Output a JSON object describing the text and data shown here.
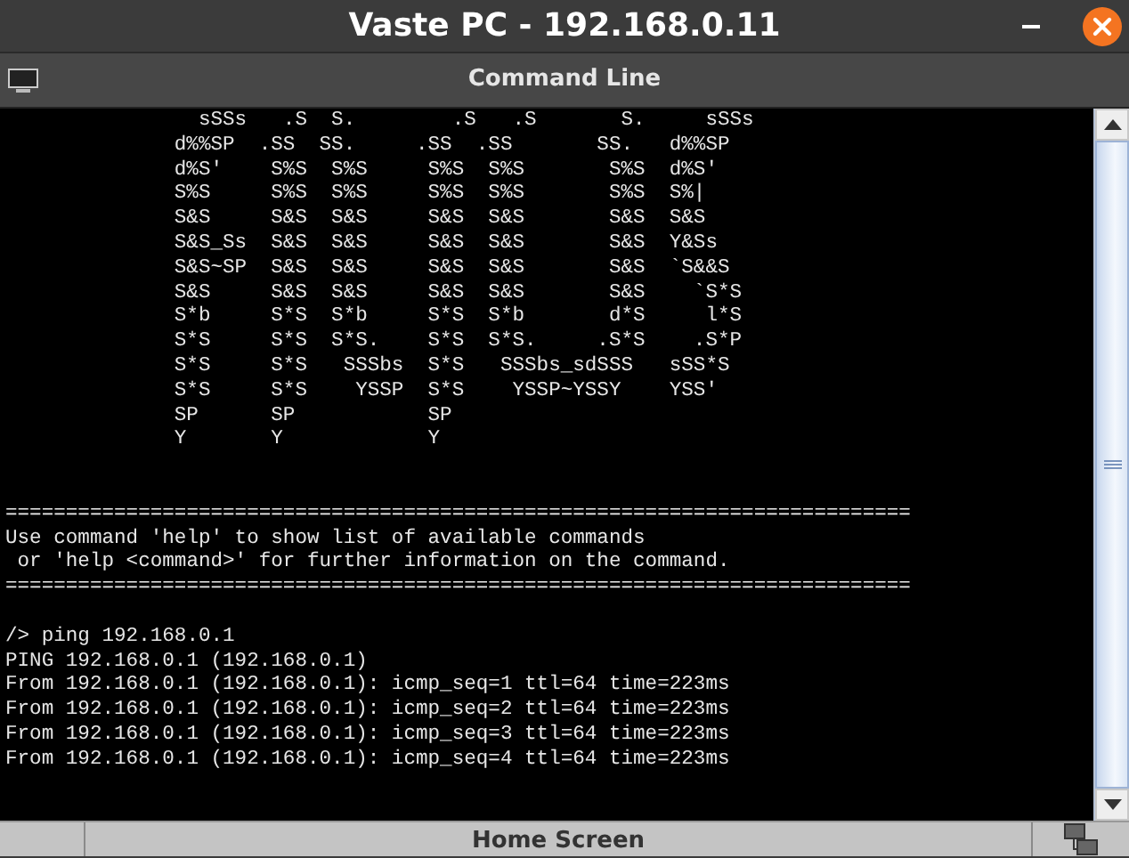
{
  "window": {
    "title": "Vaste PC - 192.168.0.11"
  },
  "panel": {
    "title": "Command Line"
  },
  "terminal": {
    "banner": [
      "  sSSs   .S  S.        .S   .S       S.     sSSs",
      "d%%SP  .SS  SS.     .SS  .SS       SS.   d%%SP",
      "d%S'    S%S  S%S     S%S  S%S       S%S  d%S'",
      "S%S     S%S  S%S     S%S  S%S       S%S  S%|",
      "S&S     S&S  S&S     S&S  S&S       S&S  S&S",
      "S&S_Ss  S&S  S&S     S&S  S&S       S&S  Y&Ss",
      "S&S~SP  S&S  S&S     S&S  S&S       S&S  `S&&S",
      "S&S     S&S  S&S     S&S  S&S       S&S    `S*S",
      "S*b     S*S  S*b     S*S  S*b       d*S     l*S",
      "S*S     S*S  S*S.    S*S  S*S.     .S*S    .S*P",
      "S*S     S*S   SSSbs  S*S   SSSbs_sdSSS   sSS*S",
      "S*S     S*S    YSSP  S*S    YSSP~YSSY    YSS'",
      "SP      SP           SP",
      "Y       Y            Y"
    ],
    "notice": [
      "===========================================================================",
      "Use command 'help' to show list of available commands",
      " or 'help <command>' for further information on the command.",
      "==========================================================================="
    ],
    "session": [
      "/> ping 192.168.0.1",
      "PING 192.168.0.1 (192.168.0.1)",
      "From 192.168.0.1 (192.168.0.1): icmp_seq=1 ttl=64 time=223ms",
      "From 192.168.0.1 (192.168.0.1): icmp_seq=2 ttl=64 time=223ms",
      "From 192.168.0.1 (192.168.0.1): icmp_seq=3 ttl=64 time=223ms",
      "From 192.168.0.1 (192.168.0.1): icmp_seq=4 ttl=64 time=223ms"
    ]
  },
  "bottom_bar": {
    "button": "Home Screen"
  }
}
